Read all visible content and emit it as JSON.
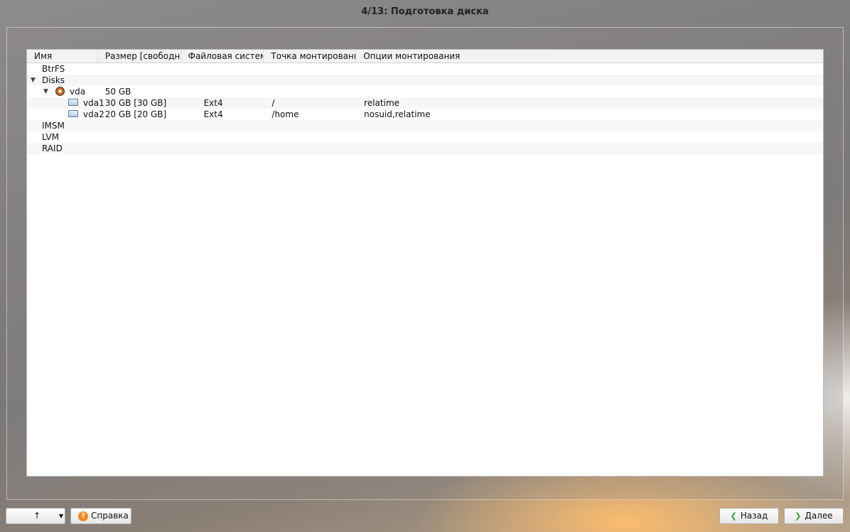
{
  "window": {
    "title": "4/13: Подготовка диска"
  },
  "table": {
    "columns": [
      "Имя",
      "Размер [свободно]",
      "Файловая система",
      "Точка монтирования",
      "Опции монтирования"
    ],
    "rows": [
      {
        "name": "BtrFS",
        "size": "",
        "fs": "",
        "mount": "",
        "options": ""
      },
      {
        "name": "Disks",
        "size": "",
        "fs": "",
        "mount": "",
        "options": ""
      },
      {
        "name": "vda",
        "size": "50 GB",
        "fs": "",
        "mount": "",
        "options": ""
      },
      {
        "name": "vda1",
        "size": "30 GB [30 GB]",
        "fs": "Ext4",
        "mount": "/",
        "options": "relatime"
      },
      {
        "name": "vda2",
        "size": "20 GB [20 GB]",
        "fs": "Ext4",
        "mount": "/home",
        "options": "nosuid,relatime"
      },
      {
        "name": "IMSM",
        "size": "",
        "fs": "",
        "mount": "",
        "options": ""
      },
      {
        "name": "LVM",
        "size": "",
        "fs": "",
        "mount": "",
        "options": ""
      },
      {
        "name": "RAID",
        "size": "",
        "fs": "",
        "mount": "",
        "options": ""
      }
    ]
  },
  "icons": {
    "expand": "triangle-down-icon",
    "disk": "hard-disk-icon",
    "partition": "partition-icon",
    "up": "arrow-up-icon",
    "help": "help-icon",
    "back": "chevron-left-icon",
    "next": "chevron-right-icon"
  },
  "buttons": {
    "up_glyph": "↑",
    "help": "Справка",
    "back": "Назад",
    "next": "Далее"
  },
  "colors": {
    "accent": "#f28a1c",
    "nav_arrow": "#3aa133"
  }
}
